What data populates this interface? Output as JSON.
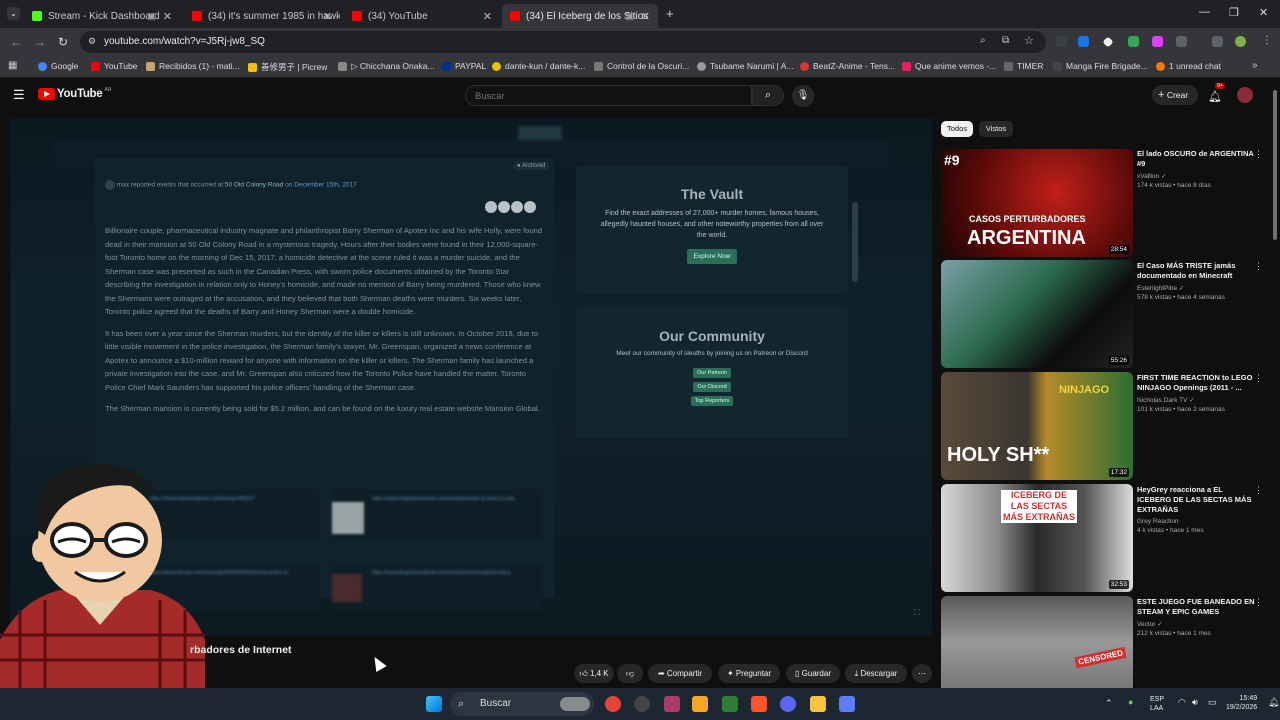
{
  "browser": {
    "tabs": [
      {
        "label": "Stream - Kick Dashboard",
        "icon": "kick-icon"
      },
      {
        "label": "(34) it's summer 1985 in hawkin",
        "icon": "youtube-icon"
      },
      {
        "label": "(34) YouTube",
        "icon": "youtube-icon"
      },
      {
        "label": "(34) El Iceberg de los Sitios",
        "icon": "youtube-icon"
      }
    ],
    "url": "youtube.com/watch?v=J5Rj-jw8_SQ",
    "bookmarks": [
      "Google",
      "YouTube",
      "Recibidos (1) - mati...",
      "善修男子 | Picrew",
      "▷ Chicchana Onaka...",
      "PAYPAL",
      "dante-kun / dante-k...",
      "Control de la Oscuri...",
      "Tsubame Narumi | A...",
      "BeatZ-Anime - Tens...",
      "Que anime vemos -...",
      "TIMER",
      "Manga Fire Brigade...",
      "1 unread chat"
    ]
  },
  "youtube": {
    "logo": "YouTube",
    "logo_sup": "AR",
    "search_placeholder": "Buscar",
    "create_label": "Crear",
    "notif_count": "9+"
  },
  "video_frame": {
    "archived": "Archived",
    "meta_user": "max",
    "meta_text": "reported events that occurred at",
    "meta_place": "50 Old Colony Road",
    "meta_on": "on",
    "meta_date": "December 15th, 2017",
    "paragraphs": [
      "Billionaire couple, pharmaceutical industry magnate and philanthropist Barry Sherman of Apotex Inc and his wife Holly, were found dead in their mansion at 50 Old Colony Road in a mysterious tragedy. Hours after their bodies were found in their 12,000-square-foot Toronto home on the morning of Dec 15, 2017, a homicide detective at the scene ruled it was a murder suicide, and the Sherman case was presented as such in the Canadian Press, with sworn police documents obtained by the Toronto Star describing the investigation in relation only to Honey's homicide, and made no mention of Barry being murdered. Those who knew the Shermans were outraged at the accusation, and they believed that both Sherman deaths were murders. Six weeks later, Toronto police agreed that the deaths of Barry and Honey Sherman were a double homicide.",
      "It has been over a year since the Sherman murders, but the identity of the killer or killers is still unknown. In October 2018, due to little visible movement in the police investigation, the Sherman family's lawyer, Mr. Greenspan, organized a news conference at Apotex to announce a $10-million reward for anyone with information on the killer or killers. The Sherman family has launched a private investigation into the case, and Mr. Greenspan also criticized how the Toronto Police have handled the matter. Toronto Police Chief Mark Saunders has supported his police officers' handling of the Sherman case.",
      "The Sherman mansion is currently being sold for $5.2 million, and can be found on the luxury real estate website Mansion Global."
    ],
    "vault_title": "The Vault",
    "vault_text": "Find the exact addresses of 27,000+ murder homes, famous houses, allegedly haunted houses, and other noteworthy properties from all over the world.",
    "vault_button": "Explore Now",
    "community_title": "Our Community",
    "community_text": "Meet our community of sleuths by joining us on Patreon or Discord",
    "community_buttons": [
      "Our Patreon",
      "Our Discord",
      "Top Reporters"
    ],
    "cards": [
      "https://www.mansionglobal.com/listings/496227",
      "https://www.theglobeandmail.com/canada/article-its-been-a-year",
      "https://www.thestar.com/news/gta/2018/01/26/toronto-police-to",
      "https://www.theglobeandmail.com/news/toronto/explainer-barry"
    ]
  },
  "video": {
    "title_visible": "rbadores de Internet",
    "likes": "1,4 K",
    "actions": [
      "Compartir",
      "Preguntar",
      "Guardar",
      "Descargar"
    ]
  },
  "sidebar": {
    "chips": [
      "Todos",
      "Vistos"
    ],
    "videos": [
      {
        "title": "El lado OSCURO de ARGENTINA #9",
        "channel": "xVallion",
        "meta": "174 k vistas • hace 8 días",
        "duration": "28:54",
        "thumb_text": [
          "CASOS PERTURBADORES",
          "ARGENTINA"
        ],
        "thumb_badge": "#9"
      },
      {
        "title": "El Caso MÁS TRISTE jamás documentado en Minecraft",
        "channel": "EsterlightPibe",
        "meta": "578 k vistas • hace 4 semanas",
        "duration": "55:26"
      },
      {
        "title": "FIRST TIME REACTION to LEGO NINJAGO Openings (2011 - ...",
        "channel": "Nicholas Dark TV",
        "meta": "101 k vistas • hace 2 semanas",
        "duration": "17:32",
        "thumb_text": [
          "HOLY SH**",
          "NINJAGO"
        ]
      },
      {
        "title": "HeyGrey reacciona a EL ICEBERG DE LAS SECTAS MÁS EXTRAÑAS",
        "channel": "Grey Reaction",
        "meta": "4 k vistas • hace 1 mes",
        "duration": "32:53",
        "thumb_text": [
          "ICEBERG DE LAS SECTAS MÁS EXTRAÑAS"
        ]
      },
      {
        "title": "ESTE JUEGO FUE BANEADO EN STEAM Y EPIC GAMES",
        "channel": "Vector",
        "meta": "212 k vistas • hace 1 mes",
        "duration": "",
        "thumb_text": [
          "CENSORED"
        ]
      }
    ]
  },
  "taskbar": {
    "search": "Buscar",
    "lang": "ESP",
    "lang2": "LAA",
    "time": "15:49",
    "date": "19/2/2026"
  },
  "colors": {
    "youtube_red": "#ff0000",
    "chrome_bg": "#202124",
    "toolbar": "#35363a",
    "yt_bg": "#0f0f0f",
    "vault_button": "#2b6e5a"
  }
}
